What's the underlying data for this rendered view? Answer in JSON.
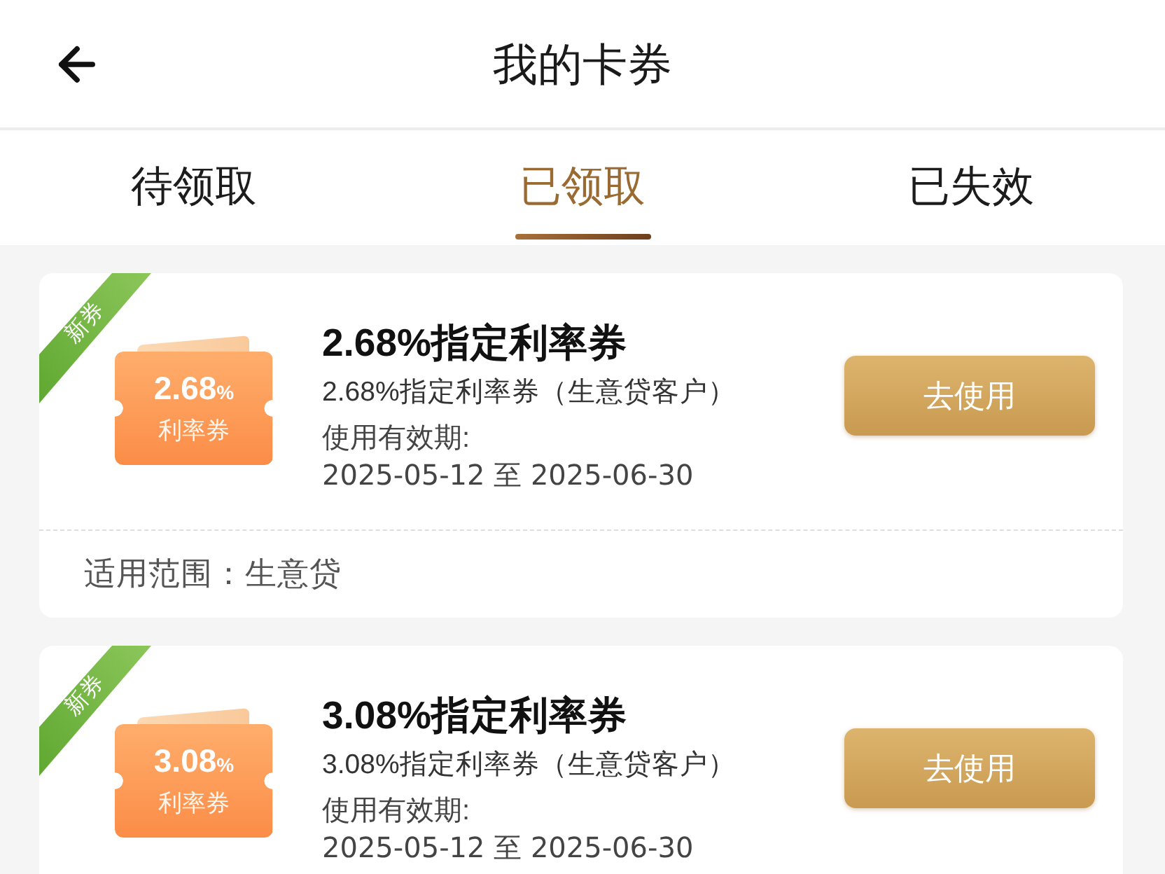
{
  "header": {
    "title": "我的卡券"
  },
  "tabs": [
    {
      "label": "待领取",
      "selected": false
    },
    {
      "label": "已领取",
      "selected": true
    },
    {
      "label": "已失效",
      "selected": false
    }
  ],
  "coupons": [
    {
      "badge": "新券",
      "ticket_rate": "2.68",
      "ticket_unit": "%",
      "ticket_label": "利率券",
      "title": "2.68%指定利率券",
      "subtitle": "2.68%指定利率券（生意贷客户）",
      "validity_label": "使用有效期:",
      "validity_dates": "2025-05-12 至 2025-06-30",
      "button": "去使用",
      "scope": "适用范围：生意贷"
    },
    {
      "badge": "新券",
      "ticket_rate": "3.08",
      "ticket_unit": "%",
      "ticket_label": "利率券",
      "title": "3.08%指定利率券",
      "subtitle": "3.08%指定利率券（生意贷客户）",
      "validity_label": "使用有效期:",
      "validity_dates": "2025-05-12 至 2025-06-30",
      "button": "去使用"
    }
  ]
}
